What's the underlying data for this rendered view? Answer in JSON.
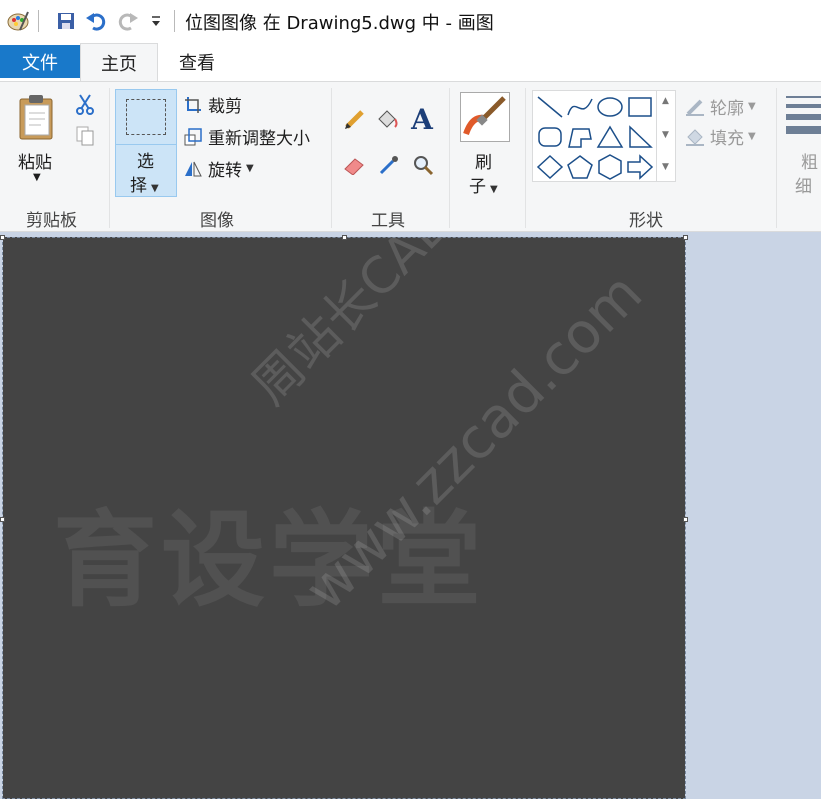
{
  "titlebar": {
    "title": "位图图像 在 Drawing5.dwg 中 - 画图"
  },
  "tabs": {
    "file": "文件",
    "home": "主页",
    "view": "查看"
  },
  "clipboard": {
    "paste_line1": "粘贴",
    "group_label": "剪贴板"
  },
  "image": {
    "select_line1": "选",
    "select_line2": "择",
    "crop": "裁剪",
    "resize": "重新调整大小",
    "rotate": "旋转",
    "group_label": "图像"
  },
  "tools": {
    "group_label": "工具"
  },
  "brushes": {
    "line1": "刷",
    "line2": "子"
  },
  "shapes": {
    "outline": "轮廓",
    "fill": "填充",
    "group_label": "形状"
  },
  "size": {
    "line1": "粗",
    "line2": "细"
  },
  "canvas": {
    "watermark_big": "育设学堂",
    "watermark_diag1": "周站长CAD",
    "watermark_diag2": "www.zzcad.com"
  },
  "colors": {
    "accent": "#1979ca",
    "ribbon_bg": "#f5f6f7",
    "canvas_fill": "#444444",
    "workspace_bg": "#c9d4e5"
  }
}
